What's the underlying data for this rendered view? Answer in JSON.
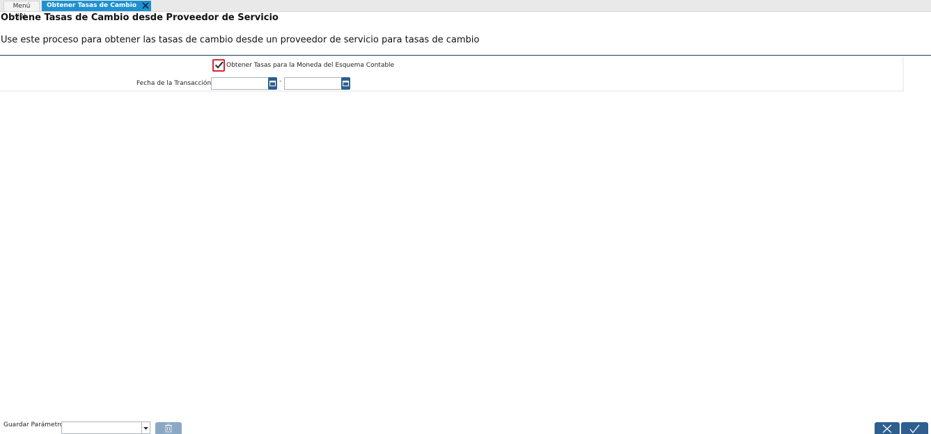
{
  "tabs": [
    {
      "label": "Menú (0)"
    },
    {
      "label": "Obtener Tasas de Cambio des..."
    }
  ],
  "process": {
    "title": "Obtiene Tasas de Cambio desde Proveedor de Servicio",
    "description": "Use este proceso para obtener las tasas de cambio desde un proveedor de servicio para tasas de cambio"
  },
  "params": {
    "checkbox_label": "Obtener Tasas para la Moneda del Esquema Contable",
    "checkbox_checked": true,
    "date_label": "Fecha de la Transacción",
    "date_from": "",
    "date_to": "",
    "range_separator": "-"
  },
  "footer": {
    "save_param_label": "Guardar Parámetro",
    "save_param_value": ""
  },
  "colors": {
    "accent": "#1f91d0",
    "button": "#2e5f8f",
    "checkbox_border": "#d9262e"
  }
}
